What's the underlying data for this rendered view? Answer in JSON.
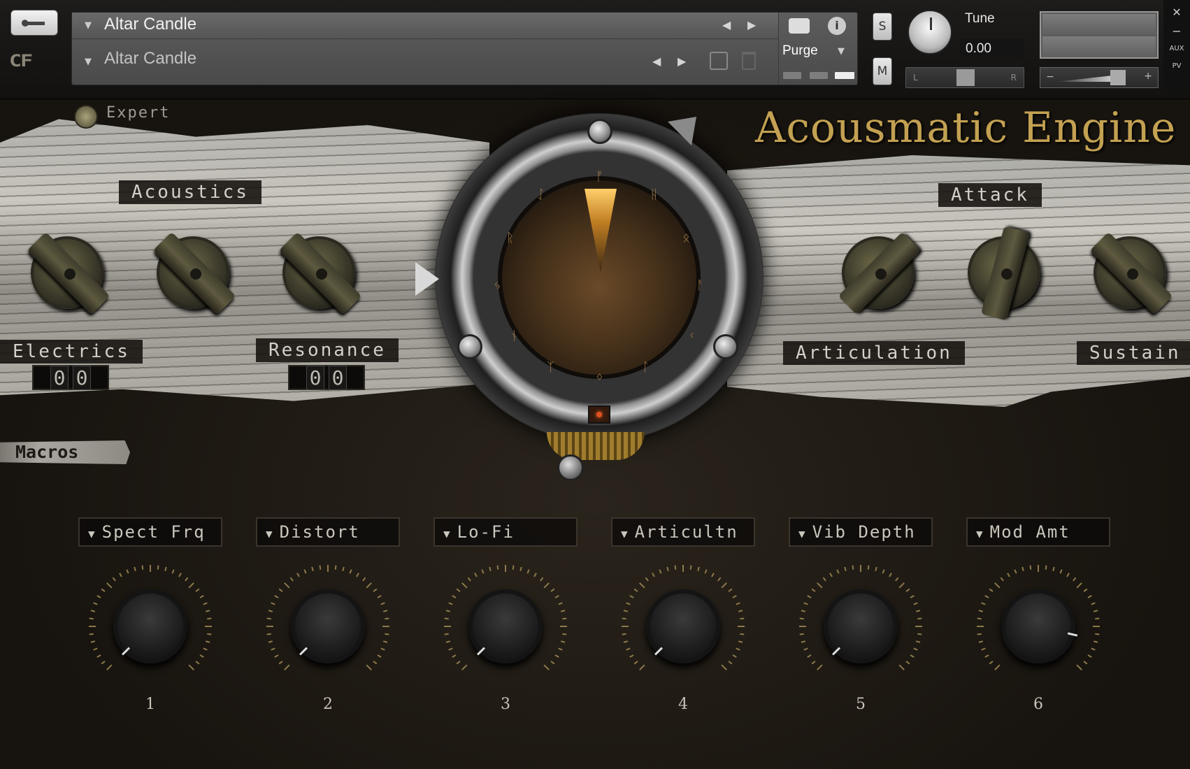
{
  "header": {
    "instrument_name": "Altar Candle",
    "patch_name": "Altar Candle",
    "purge_label": "Purge",
    "solo_label": "S",
    "mute_label": "M",
    "tune_label": "Tune",
    "tune_value": "0.00",
    "pan_left": "L",
    "pan_right": "R",
    "vol_minus": "−",
    "vol_plus": "+",
    "side_close": "✕",
    "side_min": "−",
    "side_aux": "AUX",
    "side_pv": "PV",
    "logo_text": "CF"
  },
  "instrument": {
    "title": "Acousmatic Engine",
    "expert_label": "Expert",
    "left_labels": {
      "acoustics": "Acoustics",
      "electrics": "Electrics",
      "resonance": "Resonance"
    },
    "right_labels": {
      "attack": "Attack",
      "articulation": "Articulation",
      "sustain": "Sustain"
    },
    "electrics_digits": [
      "0",
      "0"
    ],
    "resonance_digits": [
      "0",
      "0"
    ]
  },
  "macros": {
    "tab_label": "Macros",
    "items": [
      {
        "label": "Spect Frq",
        "number": "1",
        "value": 0.0
      },
      {
        "label": "Distort",
        "number": "2",
        "value": 0.0
      },
      {
        "label": "Lo-Fi",
        "number": "3",
        "value": 0.0
      },
      {
        "label": "Articultn",
        "number": "4",
        "value": 0.0
      },
      {
        "label": "Vib Depth",
        "number": "5",
        "value": 0.0
      },
      {
        "label": "Mod Amt",
        "number": "6",
        "value": 0.88
      }
    ]
  },
  "colors": {
    "title_gold": "#c3a152",
    "header_panel": "#555555",
    "wood": "#b3b0a8",
    "background": "#16130f"
  }
}
